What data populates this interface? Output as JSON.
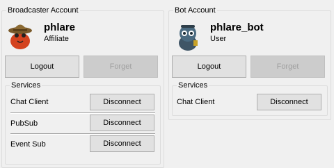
{
  "broadcaster": {
    "group_title": "Broadcaster Account",
    "username": "phlare",
    "role": "Affiliate",
    "logout_label": "Logout",
    "forget_label": "Forget",
    "services_title": "Services",
    "services": [
      {
        "label": "Chat Client",
        "button": "Disconnect"
      },
      {
        "label": "PubSub",
        "button": "Disconnect"
      },
      {
        "label": "Event Sub",
        "button": "Disconnect"
      }
    ]
  },
  "bot": {
    "group_title": "Bot Account",
    "username": "phlare_bot",
    "role": "User",
    "logout_label": "Logout",
    "forget_label": "Forget",
    "services_title": "Services",
    "services": [
      {
        "label": "Chat Client",
        "button": "Disconnect"
      }
    ]
  },
  "icons": {
    "broadcaster_avatar": "avatar-icon",
    "bot_avatar": "bot-avatar-icon"
  },
  "colors": {
    "window_bg": "#f0f0f0",
    "button_bg": "#e1e1e1",
    "button_disabled_bg": "#cccccc",
    "button_disabled_text": "#a0a0a0"
  }
}
